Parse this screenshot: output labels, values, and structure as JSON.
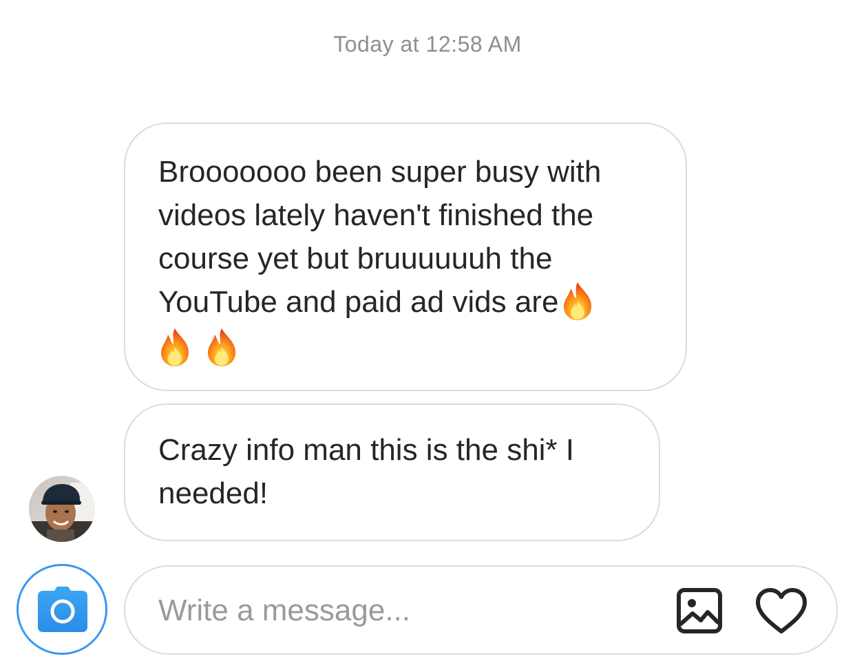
{
  "thread": {
    "timestamp": "Today at 12:58 AM",
    "messages": [
      {
        "text": "Brooooooo been super busy with videos lately haven't finished the course yet but bruuuuuuh the YouTube and paid ad vids are",
        "emoji": [
          "fire-emoji",
          "fire-emoji",
          "fire-emoji"
        ]
      },
      {
        "text": "Crazy info man this is the shi* I needed!"
      }
    ]
  },
  "composer": {
    "placeholder": "Write a message...",
    "value": ""
  },
  "icons": {
    "camera": "camera-icon",
    "gallery": "image-icon",
    "like": "heart-icon",
    "avatar": "avatar"
  },
  "colors": {
    "accent": "#3897f0",
    "bubble_border": "#dbdbdb",
    "text": "#262626",
    "meta": "#8e8e8e"
  }
}
